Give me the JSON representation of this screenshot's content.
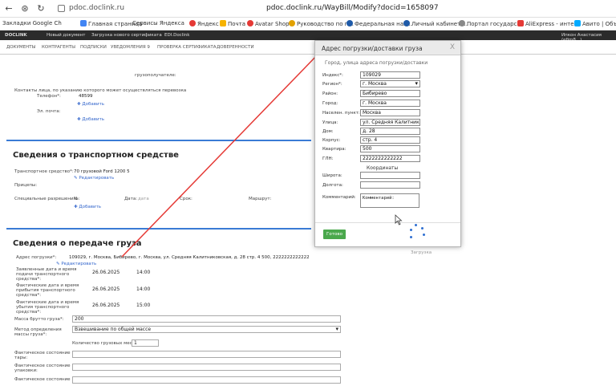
{
  "browser": {
    "url_short": "pdoc.doclink.ru",
    "url_full": "pdoc.doclink.ru/WayBill/Modify?docid=1658097",
    "bookmarks": [
      "Закладки Google Ch",
      "Главная страница",
      "Сервисы Яндекса",
      "Яндекс",
      "Почта",
      "Avatar Shop",
      "Руководство по п...",
      "Федеральная нал...",
      "Личный кабинет ...",
      "Портал государс...",
      "AliExpress - инте...",
      "Авито | Объяв..."
    ]
  },
  "app": {
    "logo": "DOCLINK",
    "header_items": [
      "Новый документ",
      "Загрузка нового сертификата",
      "EDI.Doclink"
    ],
    "user": "Ипкон Анастасия (efim8...)",
    "menu": [
      "ДОКУМЕНТЫ",
      "КОНТРАГЕНТЫ",
      "ПОДПИСКИ",
      "УВЕДОМЛЕНИЯ 9",
      "ПРОВЕРКА СЕРТИФИКАТА",
      "ДОВЕРЕННОСТИ"
    ]
  },
  "page": {
    "consignee_label": "грузополучателе:",
    "contacts_note": "Контакты лица, по указанию которого может осуществляться перевозка",
    "phone_label": "Телефон*:",
    "email_label": "Эл. почта:",
    "phone_value": "48599",
    "add": "Добавить",
    "transport_title": "Сведения о транспортном средстве",
    "vehicle_label": "Транспортное средство*:",
    "vehicle_value": "70 грузовой Ford 1200 5",
    "edit": "Редактировать",
    "trailers_label": "Прицепы:",
    "permits_label": "Специальные разрешения:",
    "permit_cols": [
      "№:",
      "Дата:",
      "дата",
      "Срок:",
      "Маршрут:"
    ],
    "cargo_title": "Сведения о передаче груза",
    "load_addr_label": "Адрес погрузки*:",
    "load_addr_value": "109029, г. Москва, Бибирево, г. Москва, ул. Средняя Калитниковская, д. 28 стр. 4 500, 2222222222222",
    "planned_label": "Заявленные дата и время подачи транспортного средства*:",
    "arrival_label": "Фактические дата и время прибытия транспортного средства*:",
    "departure_label": "Фактические дата и время убытия транспортного средства*:",
    "date1": "26.06.2025",
    "time1": "14:00",
    "date2": "26.06.2025",
    "time2": "14:00",
    "date3": "26.06.2025",
    "time3": "15:00",
    "gross_label": "Масса брутто груза*:",
    "gross_value": "200",
    "method_label": "Метод определения массы груза*:",
    "method_value": "Взвешивание по общей массе",
    "places_label": "Количество грузовых мест*:",
    "places_value": "1",
    "state1_label": "Фактическое состояние тары:",
    "state2_label": "Фактическое состояние упаковки:",
    "state3_label": "Фактическое состояние",
    "right_note": "Загрузка"
  },
  "modal": {
    "title": "Адрес погрузки/доставки груза",
    "close": "X",
    "subtitle": "Город, улица адреса погрузки/доставки",
    "fields": [
      {
        "label": "Индекс*:",
        "value": "109029"
      },
      {
        "label": "Регион*:",
        "value": "г. Москва"
      },
      {
        "label": "Район:",
        "value": "Бибирево"
      },
      {
        "label": "Город:",
        "value": "г. Москва"
      },
      {
        "label": "Населен. пункт:",
        "value": "Москва"
      },
      {
        "label": "Улица:",
        "value": "ул. Средняя Калитниковс"
      },
      {
        "label": "Дом:",
        "value": "д. 28"
      },
      {
        "label": "Корпус:",
        "value": "стр. 4"
      },
      {
        "label": "Квартира:",
        "value": "500"
      },
      {
        "label": "ГЛН:",
        "value": "2222222222222"
      }
    ],
    "coords_heading": "Координаты",
    "lat_label": "Широта:",
    "lon_label": "Долгота:",
    "comment_label": "Комментарий:",
    "comment_value": "Комментарий:",
    "save": "Готово"
  }
}
